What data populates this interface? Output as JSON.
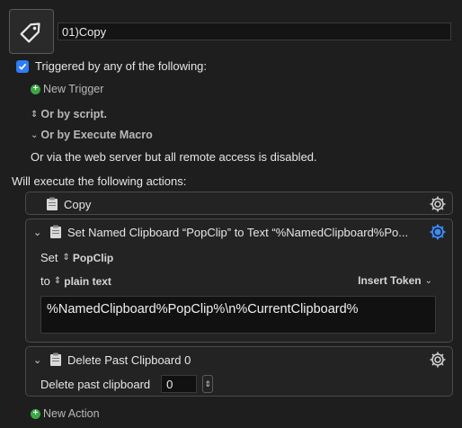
{
  "macro": {
    "name": "01)Copy",
    "icon": "tag-icon"
  },
  "triggers": {
    "header": "Triggered by any of the following:",
    "new_trigger": "New Trigger",
    "or_by_script": "Or by script.",
    "or_by_execute_macro": "Or by Execute Macro",
    "web_server_note": "Or via the web server but all remote access is disabled."
  },
  "actions_header": "Will execute the following actions:",
  "actions": [
    {
      "title": "Copy"
    },
    {
      "title": "Set Named Clipboard “PopClip” to Text “%NamedClipboard%Po...",
      "set_label": "Set",
      "clipboard_name": "PopClip",
      "to_label": "to",
      "format": "plain text",
      "insert_token": "Insert Token",
      "text": "%NamedClipboard%PopClip%\\n%CurrentClipboard%"
    },
    {
      "title": "Delete Past Clipboard 0",
      "field_label": "Delete past clipboard",
      "value": "0"
    }
  ],
  "new_action": "New Action",
  "colors": {
    "background": "#1e1e1e",
    "accent_blue": "#2f7df6",
    "green": "#3aa845"
  }
}
